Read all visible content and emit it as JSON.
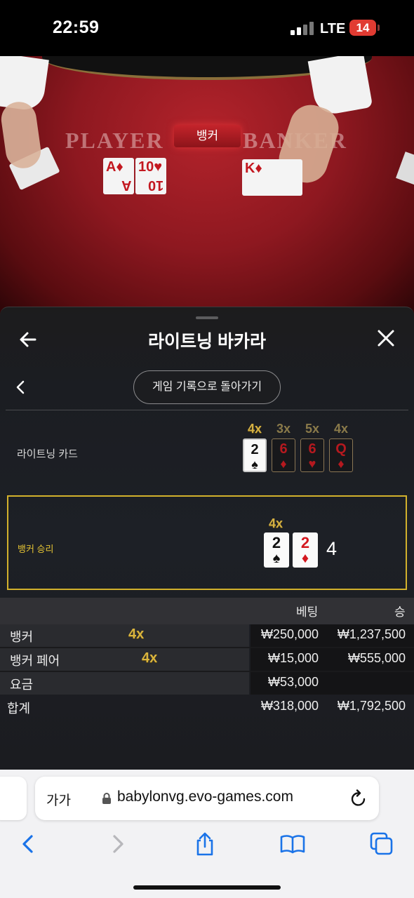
{
  "status_bar": {
    "time": "22:59",
    "network": "LTE",
    "battery": "14"
  },
  "video": {
    "felt_player": "PLAYER",
    "felt_banker": "BANKER",
    "banner": "뱅커",
    "player_cards": [
      {
        "rank": "A",
        "suit": "♦",
        "color": "red"
      },
      {
        "rank": "10",
        "suit": "♥",
        "color": "red"
      }
    ],
    "banker_cards": [
      {
        "rank": "K",
        "suit": "♦",
        "color": "red"
      }
    ]
  },
  "panel": {
    "title": "라이트닝 바카라",
    "back_to_history": "게임 기록으로 돌아가기",
    "lightning_cards_label": "라이트닝 카드",
    "lightning_cards": [
      {
        "mult": "4x",
        "rank": "2",
        "suit": "♠",
        "highlight": true
      },
      {
        "mult": "3x",
        "rank": "6",
        "suit": "♦",
        "highlight": false
      },
      {
        "mult": "5x",
        "rank": "6",
        "suit": "♥",
        "highlight": false
      },
      {
        "mult": "4x",
        "rank": "Q",
        "suit": "♦",
        "highlight": false
      }
    ],
    "result": {
      "label": "뱅커 승리",
      "mult": "4x",
      "cards": [
        {
          "rank": "2",
          "suit": "♠",
          "color": "black"
        },
        {
          "rank": "2",
          "suit": "♦",
          "color": "red"
        }
      ],
      "score": "4"
    },
    "bets": {
      "header_bet": "베팅",
      "header_win": "승",
      "rows": [
        {
          "label": "뱅커",
          "mult": "4x",
          "amount": "₩250,000",
          "payout": "₩1,237,500"
        },
        {
          "label": "뱅커 페어",
          "mult": "4x",
          "amount": "₩15,000",
          "payout": "₩555,000"
        },
        {
          "label": "요금",
          "mult": "",
          "amount": "₩53,000",
          "payout": ""
        }
      ],
      "total": {
        "label": "합계",
        "amount": "₩318,000",
        "payout": "₩1,792,500"
      }
    }
  },
  "browser": {
    "text_size": "가가",
    "url": "babylonvg.evo-games.com"
  },
  "colors": {
    "gold": "#d2b12c",
    "felt_red": "#a81e26",
    "panel_bg": "#1d2026",
    "ios_blue": "#1a73e8"
  }
}
